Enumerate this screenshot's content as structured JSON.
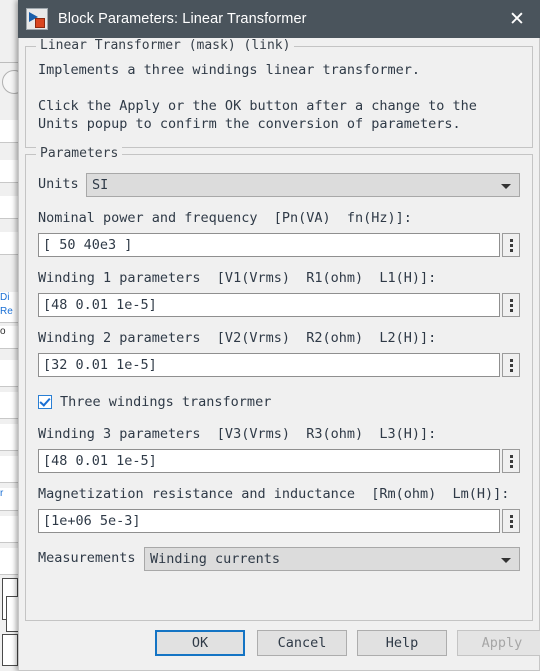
{
  "window": {
    "title": "Block Parameters: Linear Transformer",
    "icon": "simulink-block-icon",
    "close_icon": "close-icon"
  },
  "description": {
    "group_title": "Linear Transformer (mask) (link)",
    "lines": [
      "Implements a three windings linear transformer.",
      "",
      "Click the Apply or the OK button after a change to the",
      "Units popup to confirm the conversion of parameters."
    ]
  },
  "parameters": {
    "group_title": "Parameters",
    "units": {
      "label": "Units",
      "value": "SI"
    },
    "fields": [
      {
        "label": "Nominal power and frequency  [Pn(VA)  fn(Hz)]:",
        "value": "[ 50 40e3 ]"
      },
      {
        "label": "Winding 1 parameters  [V1(Vrms)  R1(ohm)  L1(H)]:",
        "value": "[48 0.01 1e-5]"
      },
      {
        "label": "Winding 2 parameters  [V2(Vrms)  R2(ohm)  L2(H)]:",
        "value": "[32 0.01 1e-5]"
      }
    ],
    "checkbox": {
      "label": "Three windings transformer",
      "checked": true
    },
    "fields2": [
      {
        "label": "Winding 3 parameters  [V3(Vrms)  R3(ohm)  L3(H)]:",
        "value": "[48 0.01 1e-5]"
      },
      {
        "label": "Magnetization resistance and inductance  [Rm(ohm)  Lm(H)]:",
        "value": "[1e+06 5e-3]"
      }
    ],
    "measurements": {
      "label": "Measurements",
      "value": "Winding currents"
    }
  },
  "buttons": {
    "ok": "OK",
    "cancel": "Cancel",
    "help": "Help",
    "apply": "Apply"
  },
  "background_window": {
    "link_1": "Di",
    "link_2": "Re",
    "link_3": "r",
    "text_1": "o"
  },
  "colors": {
    "titlebar": "#4a545c",
    "accent": "#1474c4",
    "checkbox": "#1a6fd4",
    "dialog_bg": "#f0f0f0",
    "field_bg": "#ffffff",
    "combo_bg": "#dcdcdc"
  }
}
